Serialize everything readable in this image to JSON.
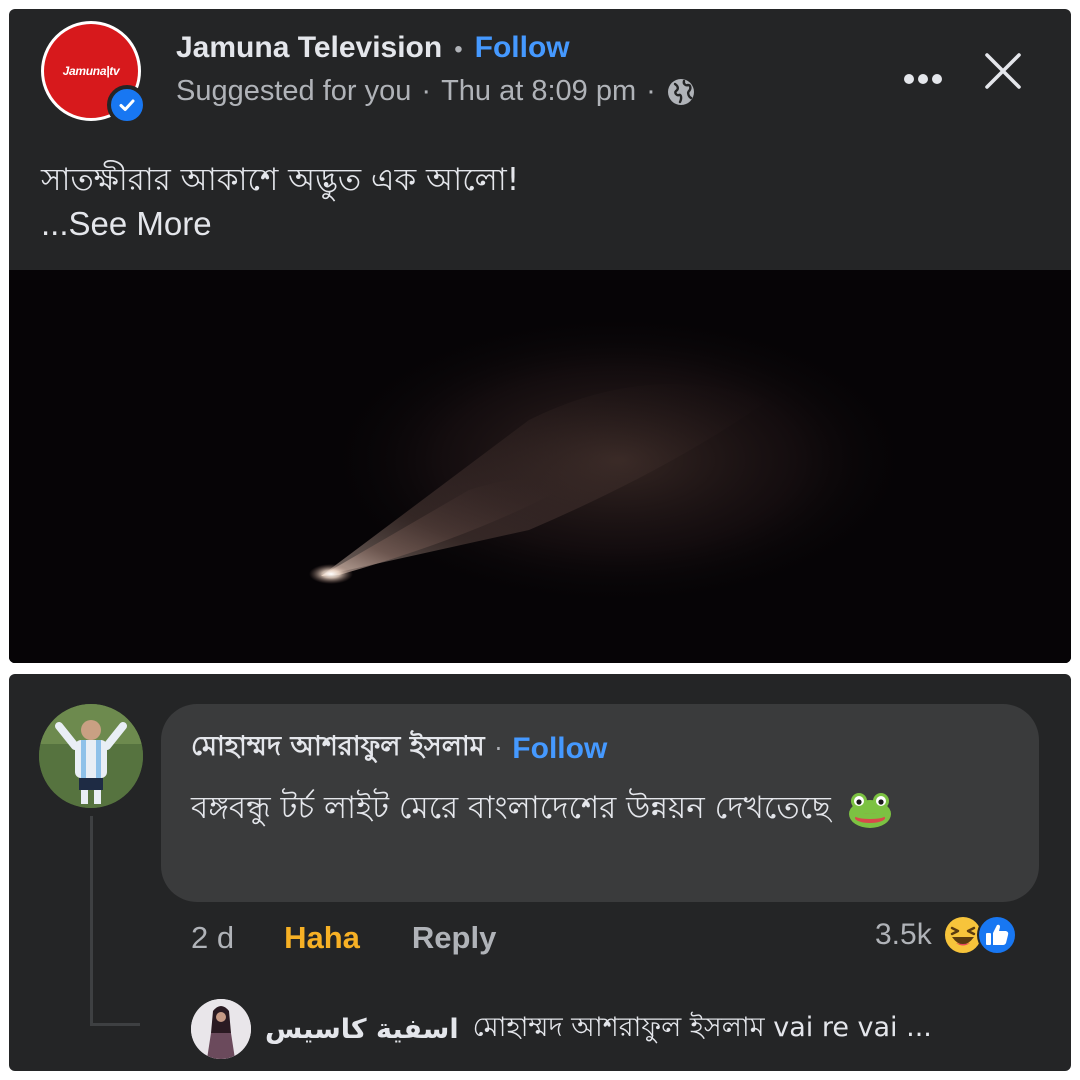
{
  "post": {
    "page_name": "Jamuna Television",
    "separator": "•",
    "follow_label": "Follow",
    "suggested": "Suggested for you",
    "meta_sep": "·",
    "time": "Thu at 8:09 pm",
    "avatar_logo_text": "Jamuna|tv",
    "text": "সাতক্ষীরার আকাশে অদ্ভুত এক আলো!",
    "see_more": "...See More",
    "icons": {
      "verified": "verified-check-icon",
      "globe": "globe-icon",
      "more": "more-options-icon",
      "close": "close-icon"
    }
  },
  "comment": {
    "author": "মোহাম্মদ আশরাফুল ইসলাম",
    "separator": "·",
    "follow_label": "Follow",
    "text": "বঙ্গবন্ধু টর্চ লাইট মেরে বাংলাদেশের উন্নয়ন দেখতেছে",
    "emoji": "frog-emoji",
    "time": "2 d",
    "haha_label": "Haha",
    "reply_label": "Reply",
    "reaction_count": "3.5k",
    "reactions": [
      "haha-reaction-icon",
      "like-reaction-icon"
    ]
  },
  "reply": {
    "author": "اسفية كاسيس",
    "text": "মোহাম্মদ আশরাফুল ইসলাম vai re vai ..."
  },
  "colors": {
    "card_bg": "#242526",
    "bubble_bg": "#3a3b3c",
    "link_blue": "#4599ff",
    "haha_yellow": "#f7b125",
    "brand_red": "#d7191c"
  }
}
